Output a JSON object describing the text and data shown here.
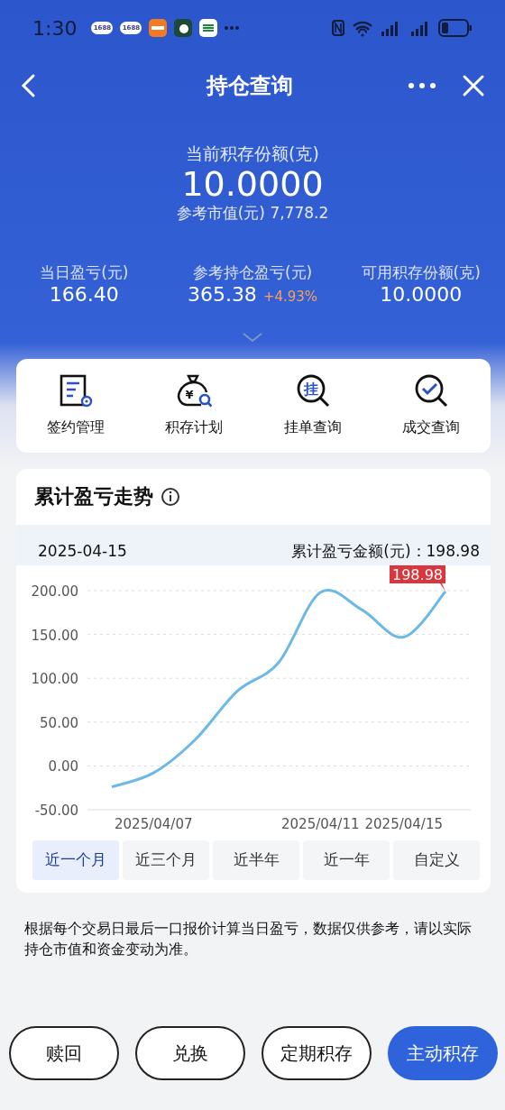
{
  "status_bar": {
    "time": "1:30",
    "notifications": [
      {
        "kind": "label",
        "text": "1688"
      },
      {
        "kind": "label",
        "text": "1688"
      },
      {
        "kind": "orange"
      },
      {
        "kind": "green"
      },
      {
        "kind": "post"
      },
      {
        "kind": "more"
      }
    ]
  },
  "nav": {
    "title": "持仓查询"
  },
  "summary": {
    "label": "当前积存份额(克)",
    "value": "10.0000",
    "market_label": "参考市值(元)",
    "market_value": "7,778.2"
  },
  "stats": [
    {
      "label": "当日盈亏(元)",
      "value": "166.40"
    },
    {
      "label": "参考持仓盈亏(元)",
      "value": "365.38",
      "change": "+4.93%"
    },
    {
      "label": "可用积存份额(克)",
      "value": "10.0000"
    }
  ],
  "quick_actions": [
    {
      "kind": "contract",
      "label": "签约管理"
    },
    {
      "kind": "bag",
      "label": "积存计划",
      "icon_text": "¥"
    },
    {
      "kind": "search-char",
      "label": "挂单查询",
      "icon_text": "挂"
    },
    {
      "kind": "search-check",
      "label": "成交查询"
    }
  ],
  "trend": {
    "title": "累计盈亏走势",
    "date": "2025-04-15",
    "amount_label": "累计盈亏金额(元)：",
    "amount": "198.98",
    "tooltip": "198.98",
    "chart_data": {
      "type": "line",
      "categories": [
        null,
        "2025/04/07",
        null,
        null,
        null,
        "2025/04/11",
        null,
        "2025/04/15",
        null
      ],
      "series": [
        {
          "color": "#6cb8e6",
          "values": [
            -24,
            -8,
            30,
            85,
            118,
            198,
            178,
            147,
            199
          ]
        }
      ],
      "ylim": [
        -50,
        200
      ],
      "yticks": [
        {
          "value": -50,
          "label": "-50.00"
        },
        {
          "value": 0,
          "label": "0.00"
        },
        {
          "value": 50,
          "label": "50.00"
        },
        {
          "value": 100,
          "label": "100.00"
        },
        {
          "value": 150,
          "label": "150.00"
        },
        {
          "value": 200,
          "label": "200.00"
        }
      ],
      "grid": true
    },
    "ranges": [
      {
        "label": "近一个月",
        "selected": true
      },
      {
        "label": "近三个月",
        "selected": false
      },
      {
        "label": "近半年",
        "selected": false
      },
      {
        "label": "近一年",
        "selected": false
      },
      {
        "label": "自定义",
        "selected": false
      }
    ]
  },
  "disclaimer": "根据每个交易日最后一口报价计算当日盈亏，数据仅供参考，请以实际持仓市值和资金变动为准。",
  "actions": [
    {
      "label": "赎回",
      "kind": "outline"
    },
    {
      "label": "兑换",
      "kind": "outline"
    },
    {
      "label": "定期积存",
      "kind": "outline"
    },
    {
      "label": "主动积存",
      "kind": "primary"
    }
  ]
}
